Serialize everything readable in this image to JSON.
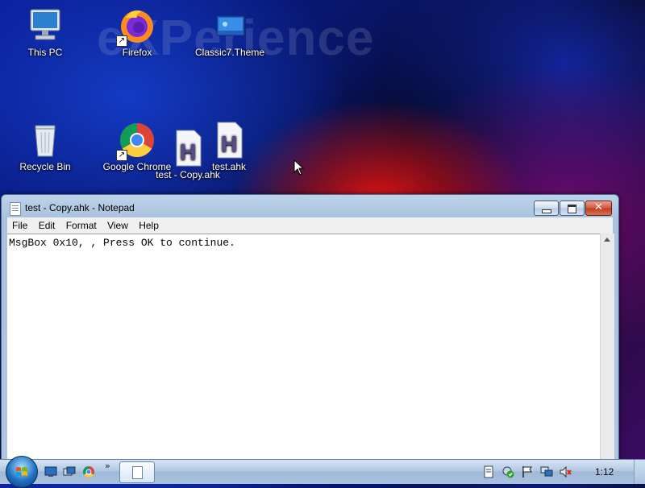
{
  "desktop": {
    "watermark": "eXPerience",
    "icons": [
      {
        "label": "This PC",
        "icon": "computer-icon"
      },
      {
        "label": "Firefox",
        "icon": "firefox-icon"
      },
      {
        "label": "Classic7.Theme",
        "icon": "theme-icon"
      },
      {
        "label": "Recycle Bin",
        "icon": "recycle-bin-icon"
      },
      {
        "label": "Google Chrome",
        "icon": "chrome-icon"
      },
      {
        "label": "test - Copy.ahk",
        "icon": "ahk-script-icon"
      },
      {
        "label": "test.ahk",
        "icon": "ahk-script-icon"
      }
    ]
  },
  "notepad": {
    "title": "test - Copy.ahk - Notepad",
    "menu": [
      "File",
      "Edit",
      "Format",
      "View",
      "Help"
    ],
    "content": "MsgBox 0x10, , Press OK to continue."
  },
  "taskbar": {
    "clock": "1:12",
    "more_chevron": "»"
  },
  "colors": {
    "titlebar": "#aec6e0",
    "close_button": "#c13a1f",
    "taskbar": "#b3c9e2"
  }
}
